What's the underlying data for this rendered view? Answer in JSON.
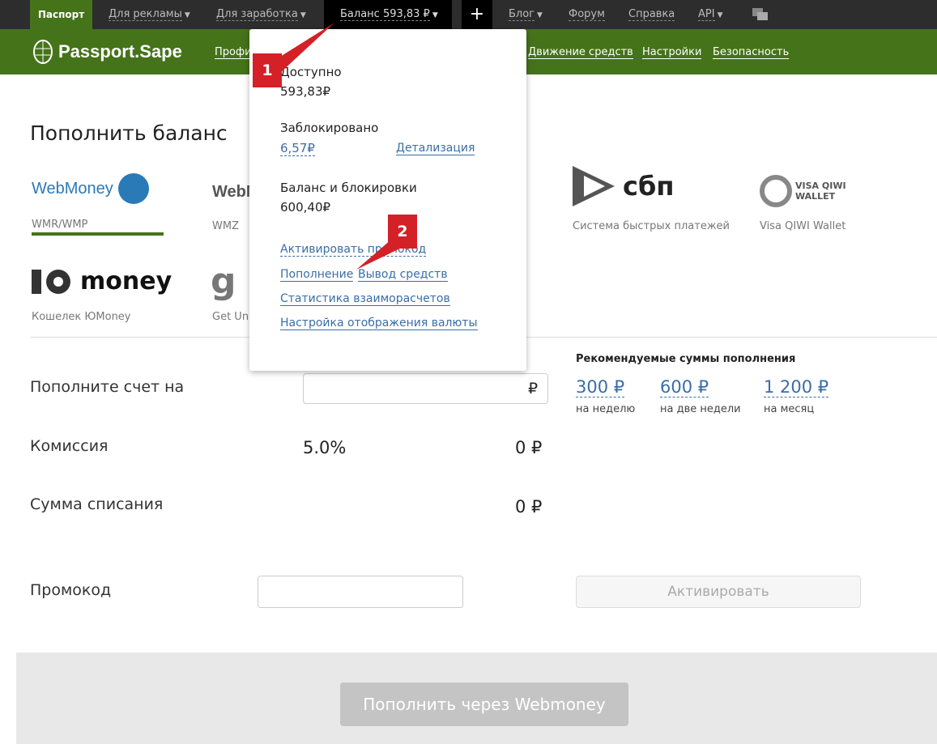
{
  "topnav": {
    "passport": "Паспорт",
    "ads": "Для рекламы",
    "earn": "Для заработка",
    "balance": "Баланс 593,83 ₽",
    "plus": "+",
    "blog": "Блог",
    "forum": "Форум",
    "help": "Справка",
    "api": "API"
  },
  "header": {
    "logo": "Passport.Sape",
    "links": [
      "Профи",
      "Движение средств",
      "Настройки",
      "Безопасность"
    ]
  },
  "page": {
    "title": "Пополнить баланс",
    "methods": [
      {
        "logo": "WebMoney",
        "label": "WMR/WMP"
      },
      {
        "logo": "WebM",
        "label": "WMZ"
      },
      {
        "logo": "сбп",
        "label": "Система быстрых платежей"
      },
      {
        "logo": "VISA QIWI WALLET",
        "label": "Visa QIWI Wallet"
      },
      {
        "logo": "money",
        "label": "Кошелек ЮMoney"
      },
      {
        "logo": "g",
        "label": "Get Uni"
      }
    ],
    "amount_label": "Пополните счет на",
    "currency": "₽",
    "commission_label": "Комиссия",
    "commission_pct": "5.0%",
    "commission_value": "0 ₽",
    "debit_label": "Сумма списания",
    "debit_value": "0 ₽",
    "promo_label": "Промокод",
    "activate": "Активировать",
    "recommended_title": "Рекомендуемые суммы пополнения",
    "recommended": [
      {
        "amount": "300 ₽",
        "period": "на неделю"
      },
      {
        "amount": "600 ₽",
        "period": "на две недели"
      },
      {
        "amount": "1 200 ₽",
        "period": "на месяц"
      }
    ],
    "submit": "Пополнить через Webmoney"
  },
  "dropdown": {
    "available_label": "Доступно",
    "available": "593,83₽",
    "blocked_label": "Заблокировано",
    "blocked": "6,57₽",
    "details": "Детализация",
    "total_label": "Баланс и блокировки",
    "total": "600,40₽",
    "promo": "Активировать промокод",
    "topup": "Пополнение",
    "withdraw": "Вывод средств",
    "stats": "Статистика взаиморасчетов",
    "currency_settings": "Настройка отображения валюты"
  },
  "annotations": [
    "1",
    "2"
  ],
  "colors": {
    "green": "#45731a",
    "link": "#3a6ea5",
    "marker": "#d42027"
  }
}
